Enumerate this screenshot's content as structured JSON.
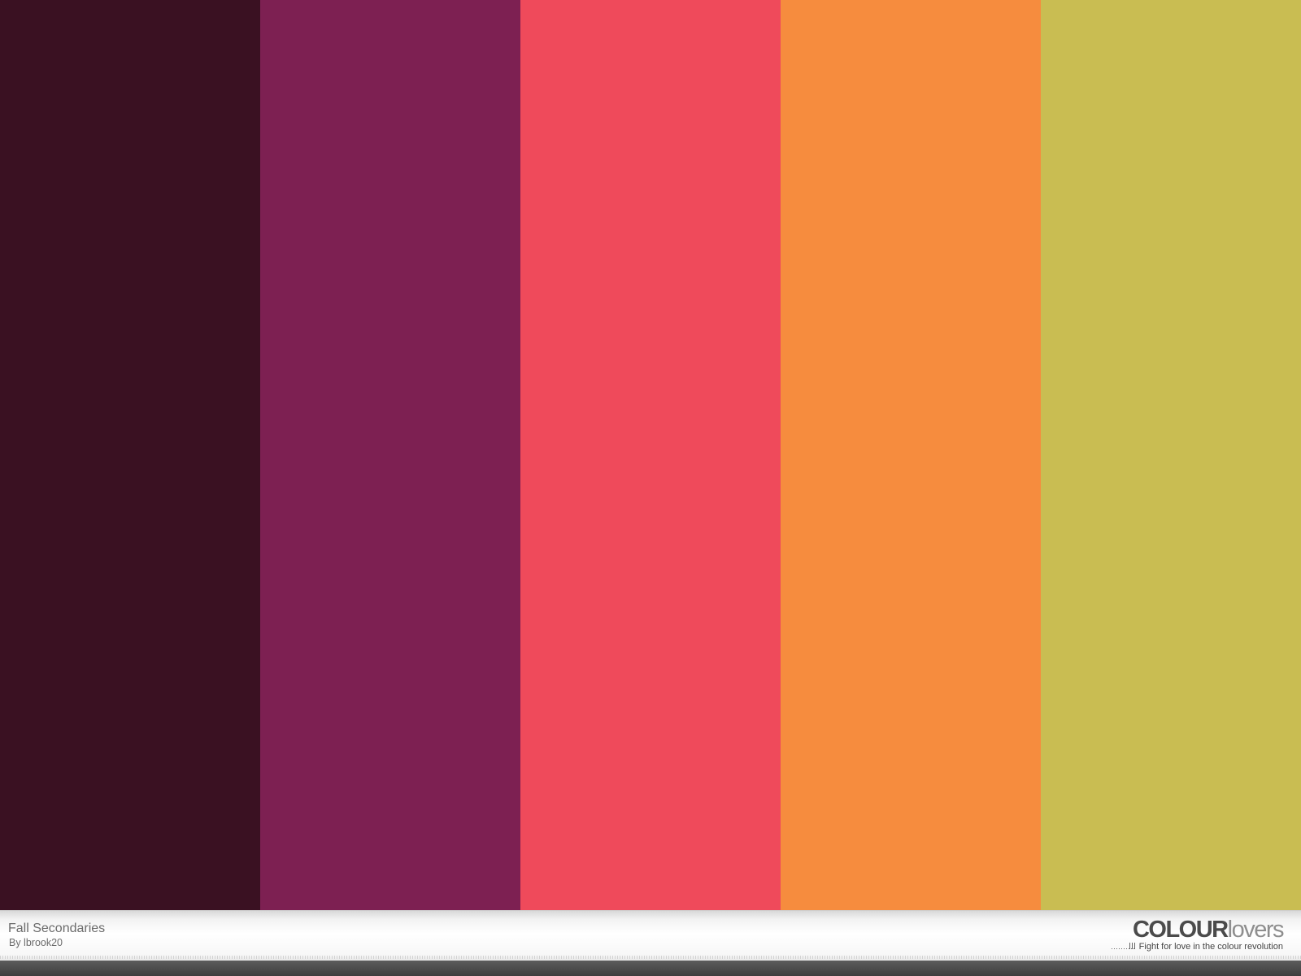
{
  "palette": {
    "title": "Fall Secondaries",
    "author": "By lbrook20",
    "colors": [
      "#3a1122",
      "#7d2052",
      "#ef4a5b",
      "#f68c3e",
      "#c9bd52"
    ]
  },
  "branding": {
    "logo_bold": "COLOUR",
    "logo_light": "lovers",
    "tagline": "Fight for love in the colour revolution"
  }
}
